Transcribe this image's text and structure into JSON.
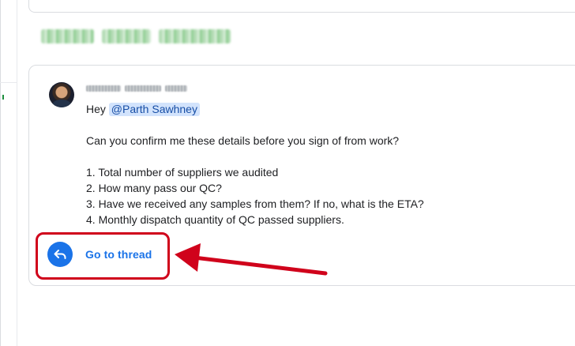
{
  "message": {
    "greeting": "Hey ",
    "mention": "@Parth Sawhney",
    "question": "Can you confirm me these details before you sign of from work?",
    "items": [
      "1. Total number of suppliers we audited",
      "2. How many pass our QC?",
      "3. Have we received any samples from them? If no, what is the ETA?",
      "4. Monthly dispatch quantity of QC passed suppliers."
    ]
  },
  "thread_link": {
    "label": "Go to thread",
    "icon": "reply-arrow-icon"
  },
  "colors": {
    "accent": "#1a73e8",
    "mention_bg": "#d2e3fc",
    "annotation": "#d0021b"
  }
}
